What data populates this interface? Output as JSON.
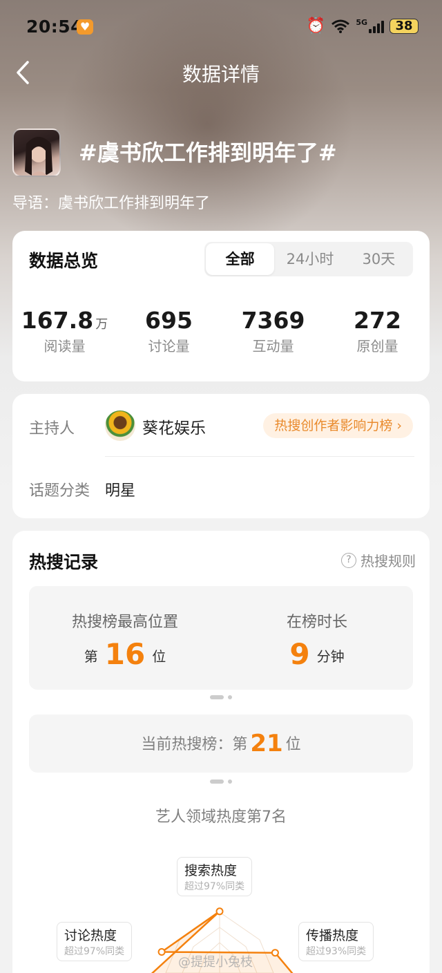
{
  "status_bar": {
    "time": "20:54",
    "network": "5G",
    "battery": "38",
    "icons": [
      "app-heart-icon",
      "alarm-icon",
      "wifi-icon",
      "signal-icon",
      "battery-icon"
    ]
  },
  "nav": {
    "title": "数据详情",
    "back_icon": "chevron-left-icon"
  },
  "topic": {
    "title": "#虞书欣工作排到明年了#",
    "lead": "导语：虞书欣工作排到明年了"
  },
  "overview": {
    "title": "数据总览",
    "tabs": [
      {
        "label": "全部",
        "active": true
      },
      {
        "label": "24小时",
        "active": false
      },
      {
        "label": "30天",
        "active": false
      }
    ],
    "stats": [
      {
        "value": "167.8",
        "unit": "万",
        "label": "阅读量"
      },
      {
        "value": "695",
        "unit": "",
        "label": "讨论量"
      },
      {
        "value": "7369",
        "unit": "",
        "label": "互动量"
      },
      {
        "value": "272",
        "unit": "",
        "label": "原创量"
      }
    ]
  },
  "host": {
    "label": "主持人",
    "name": "葵花娱乐",
    "rank_link": "热搜创作者影响力榜",
    "category_label": "话题分类",
    "category": "明星"
  },
  "hot": {
    "title": "热搜记录",
    "rule_label": "热搜规则",
    "peak_label": "热搜榜最高位置",
    "peak_prefix": "第",
    "peak_value": "16",
    "peak_suffix": "位",
    "duration_label": "在榜时长",
    "duration_value": "9",
    "duration_unit": "分钟",
    "current_label": "当前热搜榜：第",
    "current_value": "21",
    "current_suffix": "位",
    "field_rank": "艺人领域热度第7名",
    "radar": [
      {
        "name": "搜索热度",
        "note": "超过97%同类",
        "level": 0.97
      },
      {
        "name": "讨论热度",
        "note": "超过97%同类",
        "level": 0.97
      },
      {
        "name": "传播热度",
        "note": "超过93%同类",
        "level": 0.93
      }
    ],
    "accent_color": "#f4810e"
  },
  "watermark": "@提提小兔枝"
}
